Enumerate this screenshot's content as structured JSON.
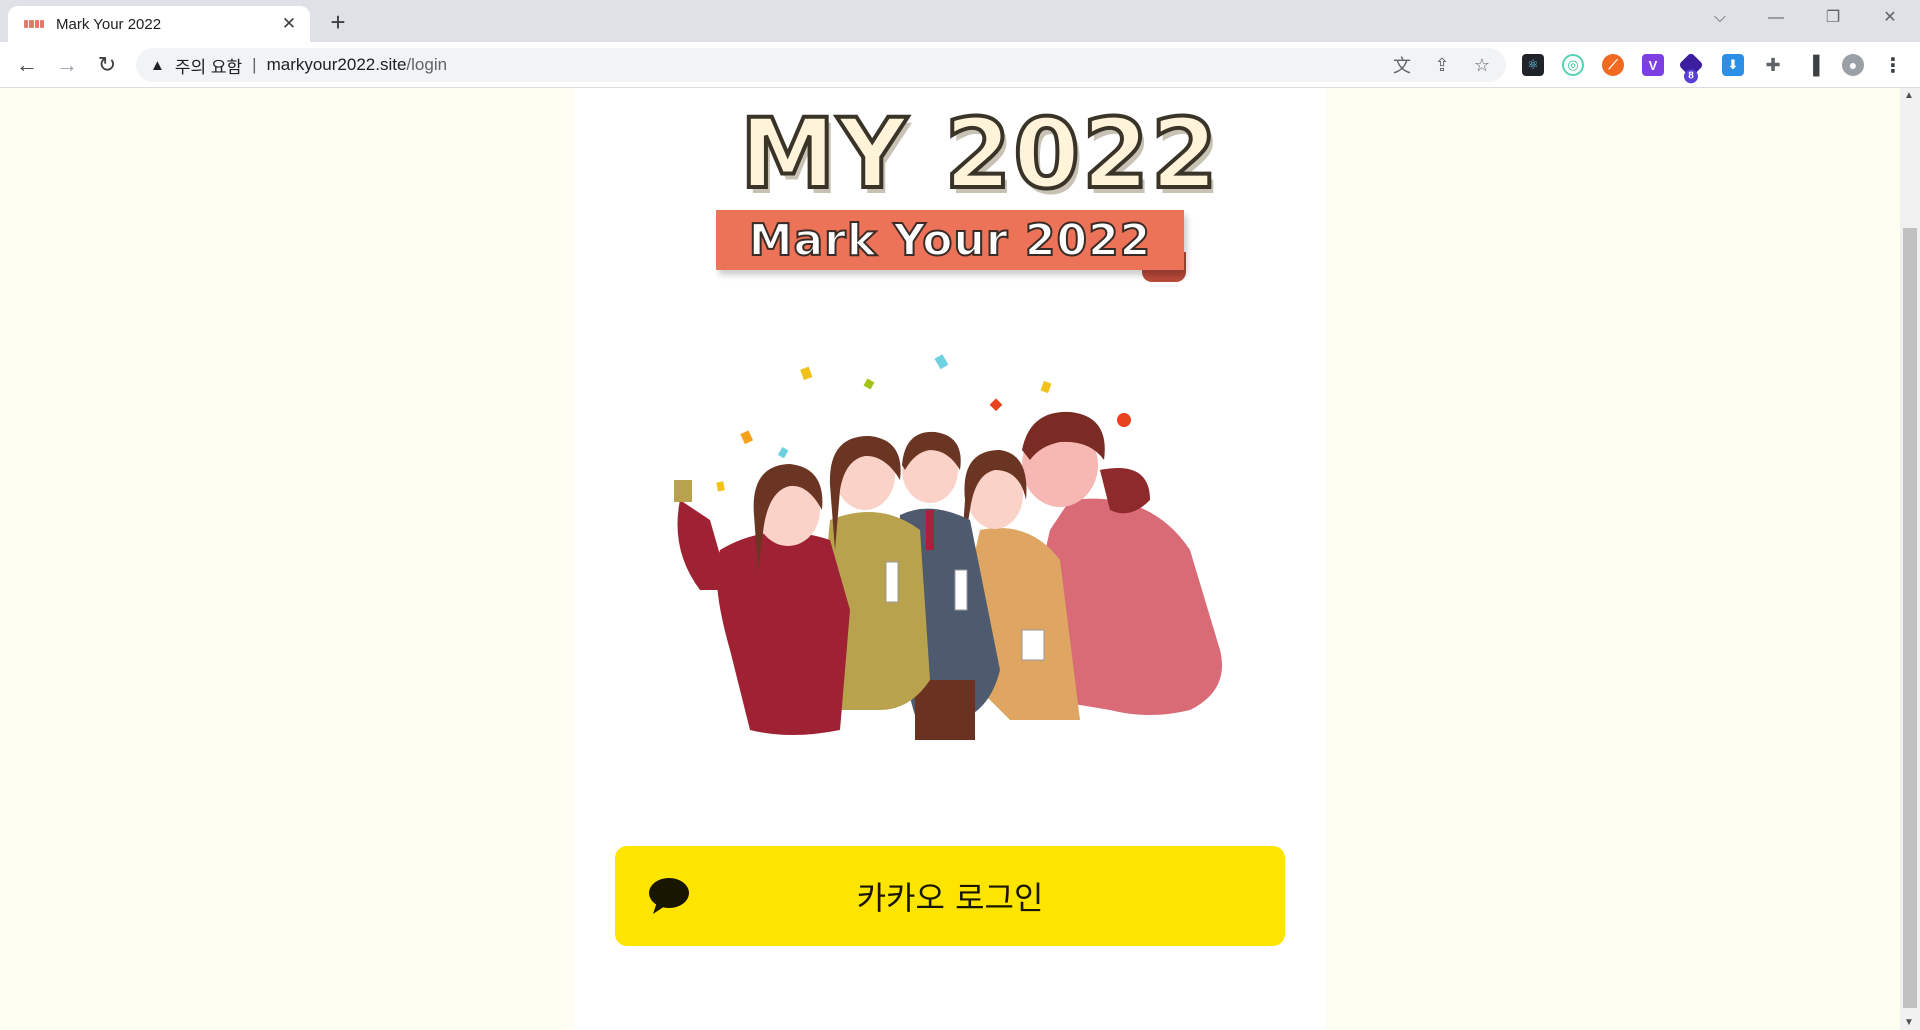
{
  "browser": {
    "tab_title": "Mark Your 2022",
    "new_tab_label": "+",
    "security_warning": "주의 요함",
    "separator": "|",
    "url_host": "markyour2022.site",
    "url_path": "/login"
  },
  "page": {
    "logo_title": "MY 2022",
    "logo_subtitle": "Mark Your 2022",
    "login_button_label": "카카오 로그인"
  },
  "colors": {
    "page_bg": "#fffef2",
    "kakao_yellow": "#fee500",
    "ribbon": "#ec7358"
  },
  "icons": {
    "back": "arrow-left-icon",
    "forward": "arrow-right-icon",
    "reload": "reload-icon",
    "kakao": "speech-bubble-icon"
  },
  "extensions": {
    "badge_count": "8"
  }
}
